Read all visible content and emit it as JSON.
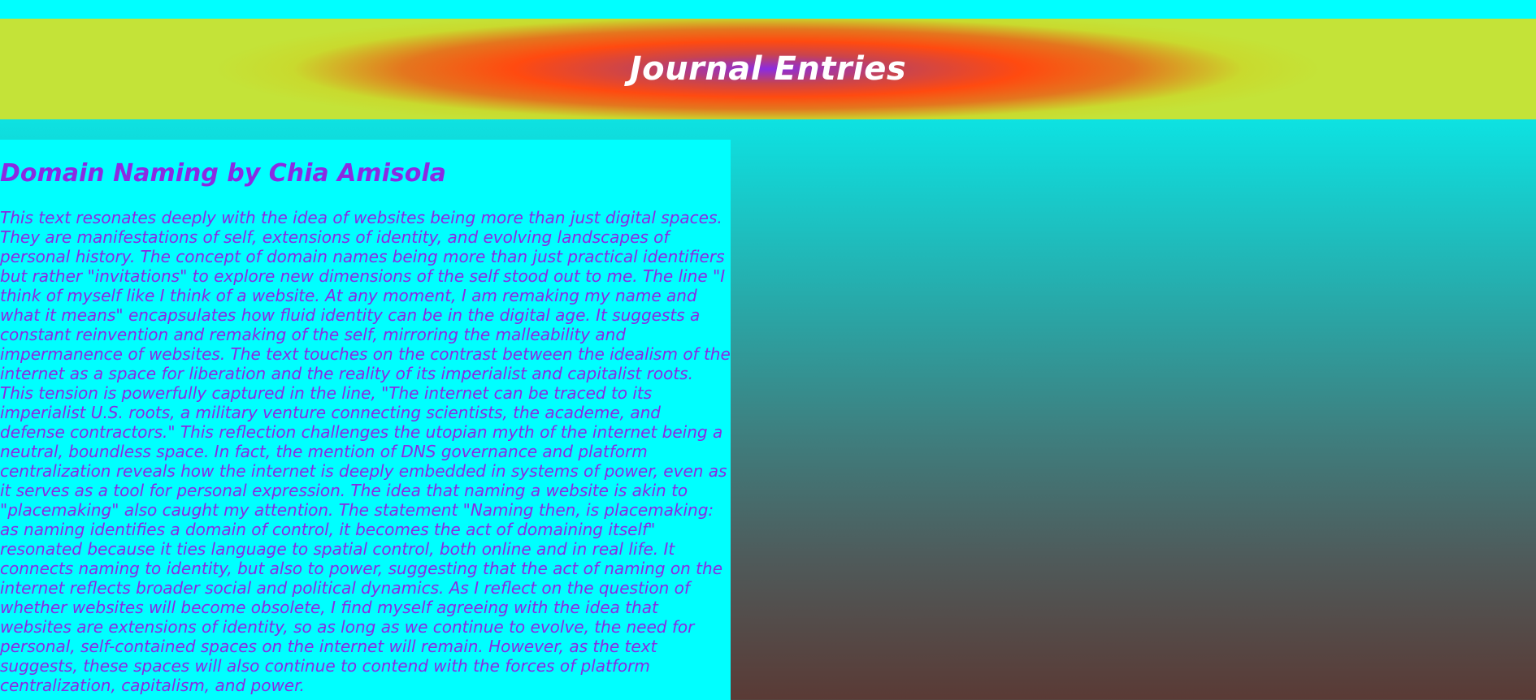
{
  "header": {
    "title": "Journal Entries"
  },
  "entry": {
    "title": "Domain Naming by Chia Amisola",
    "body": "This text resonates deeply with the idea of websites being more than just digital spaces. They are manifestations of self, extensions of identity, and evolving landscapes of personal history. The concept of domain names being more than just practical identifiers but rather \"invitations\" to explore new dimensions of the self stood out to me. The line \"I think of myself like I think of a website. At any moment, I am remaking my name and what it means\" encapsulates how fluid identity can be in the digital age. It suggests a constant reinvention and remaking of the self, mirroring the malleability and impermanence of websites. The text touches on the contrast between the idealism of the internet as a space for liberation and the reality of its imperialist and capitalist roots. This tension is powerfully captured in the line, \"The internet can be traced to its imperialist U.S. roots, a military venture connecting scientists, the academe, and defense contractors.\" This reflection challenges the utopian myth of the internet being a neutral, boundless space. In fact, the mention of DNS governance and platform centralization reveals how the internet is deeply embedded in systems of power, even as it serves as a tool for personal expression. The idea that naming a website is akin to \"placemaking\" also caught my attention. The statement \"Naming then, is placemaking: as naming identifies a domain of control, it becomes the act of domaining itself\" resonated because it ties language to spatial control, both online and in real life. It connects naming to identity, but also to power, suggesting that the act of naming on the internet reflects broader social and political dynamics. As I reflect on the question of whether websites will become obsolete, I find myself agreeing with the idea that websites are extensions of identity, so as long as we continue to evolve, the need for personal, self-contained spaces on the internet will remain. However, as the text suggests, these spaces will also continue to contend with the forces of platform centralization, capitalism, and power."
  },
  "colors": {
    "accent_text": "#8a2be2",
    "card_background": "#00ffff",
    "header_text": "#ffffff"
  }
}
